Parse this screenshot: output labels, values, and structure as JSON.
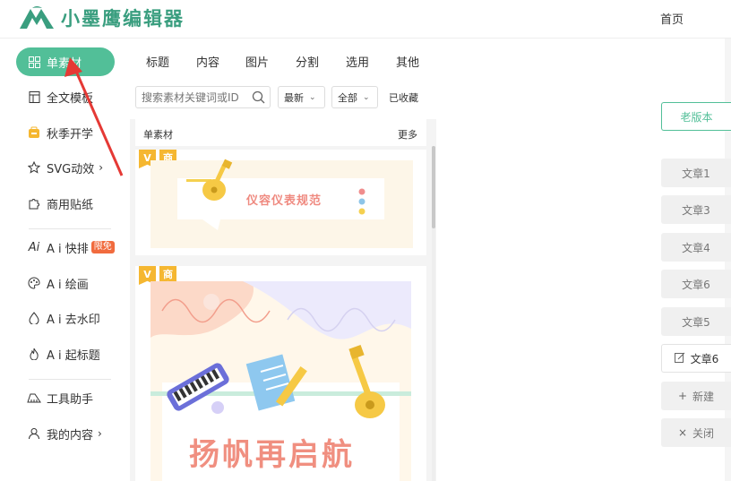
{
  "header": {
    "logo_text": "小墨鹰编辑器",
    "home_link": "首页"
  },
  "sidebar": {
    "items": [
      {
        "label": "单素材",
        "icon": "grid-icon"
      },
      {
        "label": "全文模板",
        "icon": "template-icon"
      },
      {
        "label": "秋季开学",
        "icon": "bag-icon"
      },
      {
        "label": "SVG动效",
        "icon": "star-icon"
      },
      {
        "label": "商用贴纸",
        "icon": "puzzle-icon"
      },
      {
        "label": "A i 快排",
        "icon": "ai-icon",
        "badge": "限免"
      },
      {
        "label": "A i 绘画",
        "icon": "palette-icon"
      },
      {
        "label": "A i 去水印",
        "icon": "drop-icon"
      },
      {
        "label": "A i 起标题",
        "icon": "fire-icon"
      },
      {
        "label": "工具助手",
        "icon": "piano-icon"
      },
      {
        "label": "我的内容",
        "icon": "user-icon"
      }
    ],
    "active_color": "#52bf98"
  },
  "panel": {
    "tabs": [
      "标题",
      "内容",
      "图片",
      "分割",
      "选用",
      "其他"
    ],
    "search_placeholder": "搜索素材关键词或ID",
    "sort_select": "最新",
    "scope_select": "全部",
    "favorites": "已收藏",
    "list_title": "单素材",
    "more": "更多",
    "cards": [
      {
        "tags": [
          "V",
          "商"
        ],
        "banner_text": "仪容仪表规范"
      },
      {
        "tags": [
          "V",
          "商"
        ],
        "headline": "扬帆再启航"
      }
    ]
  },
  "right": {
    "old_version": "老版本",
    "articles": [
      "文章1",
      "文章3",
      "文章4",
      "文章6",
      "文章5",
      "文章6"
    ],
    "new_label": "新建",
    "close_label": "关闭"
  }
}
